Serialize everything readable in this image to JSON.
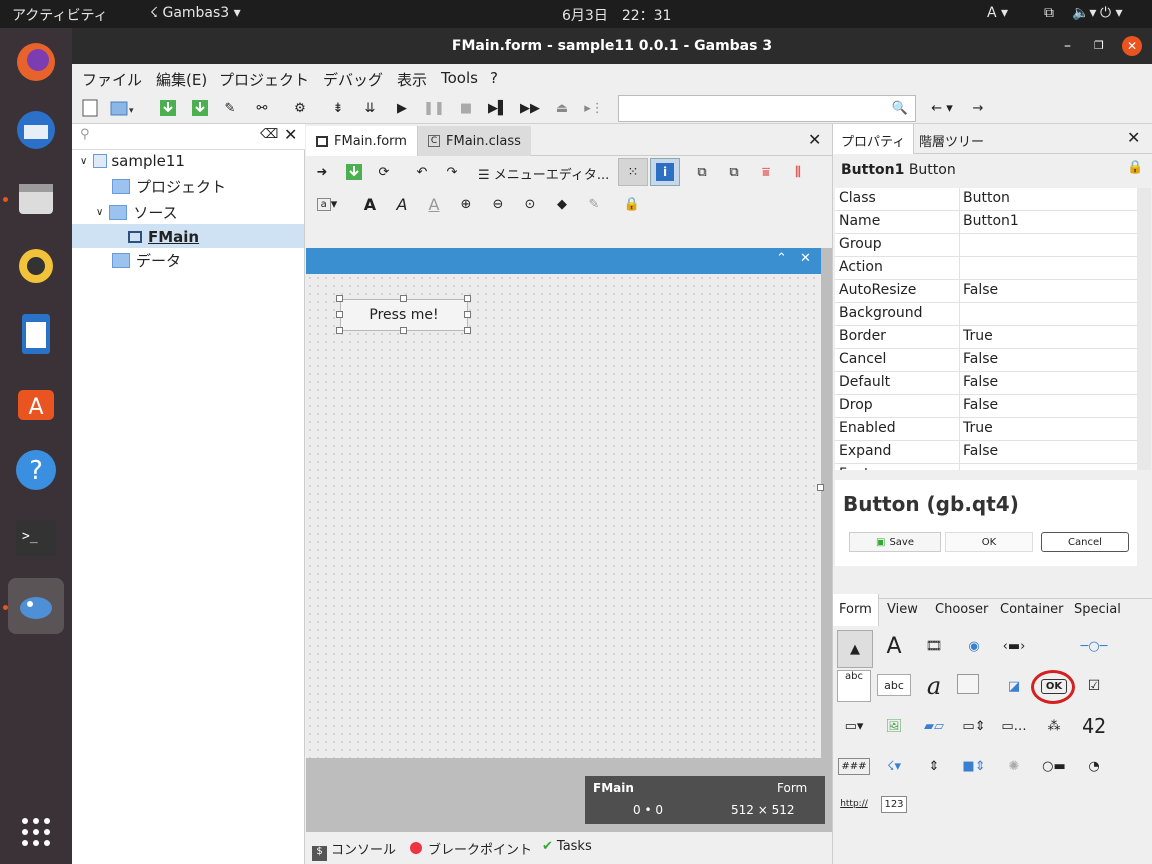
{
  "topbar": {
    "activities": "アクティビティ",
    "app": "Gambas3",
    "clock": "6月3日　22：31",
    "input": "A"
  },
  "window": {
    "title": "FMain.form - sample11 0.0.1 - Gambas 3"
  },
  "menu": [
    "ファイル",
    "編集(E)",
    "プロジェクト",
    "デバッグ",
    "表示",
    "Tools",
    "?"
  ],
  "tree": {
    "root": "sample11",
    "project": "プロジェクト",
    "source": "ソース",
    "fmain": "FMain",
    "data": "データ"
  },
  "editor": {
    "tab_form": "FMain.form",
    "tab_class": "FMain.class",
    "menu_editor": "メニューエディタ...",
    "button_text": "Press me!",
    "status_name": "FMain",
    "status_type": "Form",
    "status_pos": "0 • 0",
    "status_size": "512 × 512"
  },
  "bottom": {
    "console": "コンソール",
    "breakpoints": "ブレークポイント",
    "tasks": "Tasks"
  },
  "properties": {
    "tab_props": "プロパティ",
    "tab_tree": "階層ツリー",
    "selected_name": "Button1",
    "selected_class": "Button",
    "rows": [
      [
        "Class",
        "Button"
      ],
      [
        "Name",
        "Button1"
      ],
      [
        "Group",
        ""
      ],
      [
        "Action",
        ""
      ],
      [
        "AutoResize",
        "False"
      ],
      [
        "Background",
        ""
      ],
      [
        "Border",
        "True"
      ],
      [
        "Cancel",
        "False"
      ],
      [
        "Default",
        "False"
      ],
      [
        "Drop",
        "False"
      ],
      [
        "Enabled",
        "True"
      ],
      [
        "Expand",
        "False"
      ],
      [
        "Font",
        ""
      ]
    ]
  },
  "help": {
    "title": "Button (gb.qt4)",
    "save": "Save",
    "ok": "OK",
    "cancel": "Cancel"
  },
  "toolbox": {
    "tabs": [
      "Form",
      "View",
      "Chooser",
      "Container",
      "Special"
    ],
    "label_abc": "abc",
    "label_ok": "OK",
    "label_hash": "###",
    "label_http": "http://",
    "label_123": "123",
    "label_42": "42"
  }
}
